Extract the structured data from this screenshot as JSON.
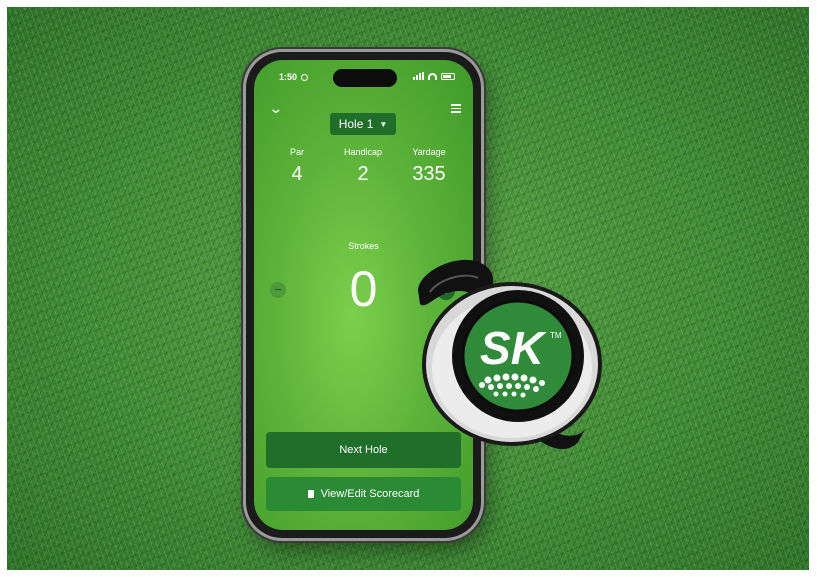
{
  "status_bar": {
    "time": "1:50"
  },
  "hole_select": {
    "label": "Hole 1"
  },
  "stats": [
    {
      "label": "Par",
      "value": "4"
    },
    {
      "label": "Handicap",
      "value": "2"
    },
    {
      "label": "Yardage",
      "value": "335"
    }
  ],
  "strokes": {
    "label": "Strokes",
    "value": "0",
    "minus": "−",
    "plus": "+"
  },
  "buttons": {
    "next_hole": "Next Hole",
    "scorecard": "View/Edit Scorecard"
  },
  "device": {
    "logo_text": "SK",
    "trademark": "TM"
  },
  "colors": {
    "screen_green": "#5eb43a",
    "button_dark": "#1f6e2a",
    "button_mid": "#2b8a34",
    "device_green": "#2f8a3a"
  }
}
